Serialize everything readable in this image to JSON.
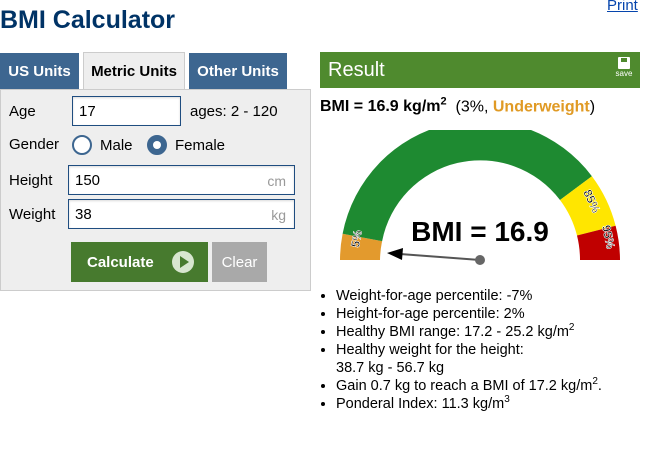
{
  "page": {
    "title": "BMI Calculator",
    "print_label": "Print"
  },
  "tabs": [
    {
      "label": "US Units",
      "active": false
    },
    {
      "label": "Metric Units",
      "active": true
    },
    {
      "label": "Other Units",
      "active": false
    }
  ],
  "form": {
    "age_label": "Age",
    "age_value": "17",
    "age_hint": "ages: 2 - 120",
    "gender_label": "Gender",
    "gender_options": [
      "Male",
      "Female"
    ],
    "gender_selected": "Female",
    "height_label": "Height",
    "height_value": "150",
    "height_unit": "cm",
    "weight_label": "Weight",
    "weight_value": "38",
    "weight_unit": "kg",
    "calculate_label": "Calculate",
    "clear_label": "Clear"
  },
  "result": {
    "header": "Result",
    "save_label": "save",
    "bmi_prefix": "BMI = 16.9 kg/m",
    "bmi_exp": "2",
    "percent_text": "(3%, ",
    "category": "Underweight",
    "category_close": ")",
    "gauge_text": "BMI = 16.9",
    "gauge_labels": {
      "p5": "5%",
      "p85": "85%",
      "p95": "95%"
    },
    "colors": {
      "green": "#1e8a31",
      "orange": "#e39a2d",
      "yellow": "#ffe600",
      "red": "#c00000",
      "header": "#4f8a2e",
      "tab": "#3d6690"
    },
    "bullets": [
      {
        "text": "Weight-for-age percentile: -7%",
        "sup": "",
        "tail": ""
      },
      {
        "text": "Height-for-age percentile: 2%",
        "sup": "",
        "tail": ""
      },
      {
        "text": "Healthy BMI range: 17.2 - 25.2 kg/m",
        "sup": "2",
        "tail": ""
      },
      {
        "text": "Healthy weight for the height:",
        "line2": "38.7 kg - 56.7 kg"
      },
      {
        "text": "Gain 0.7 kg to reach a BMI of 17.2 kg/m",
        "sup": "2",
        "tail": "."
      },
      {
        "text": "Ponderal Index: 11.3 kg/m",
        "sup": "3",
        "tail": ""
      }
    ]
  }
}
